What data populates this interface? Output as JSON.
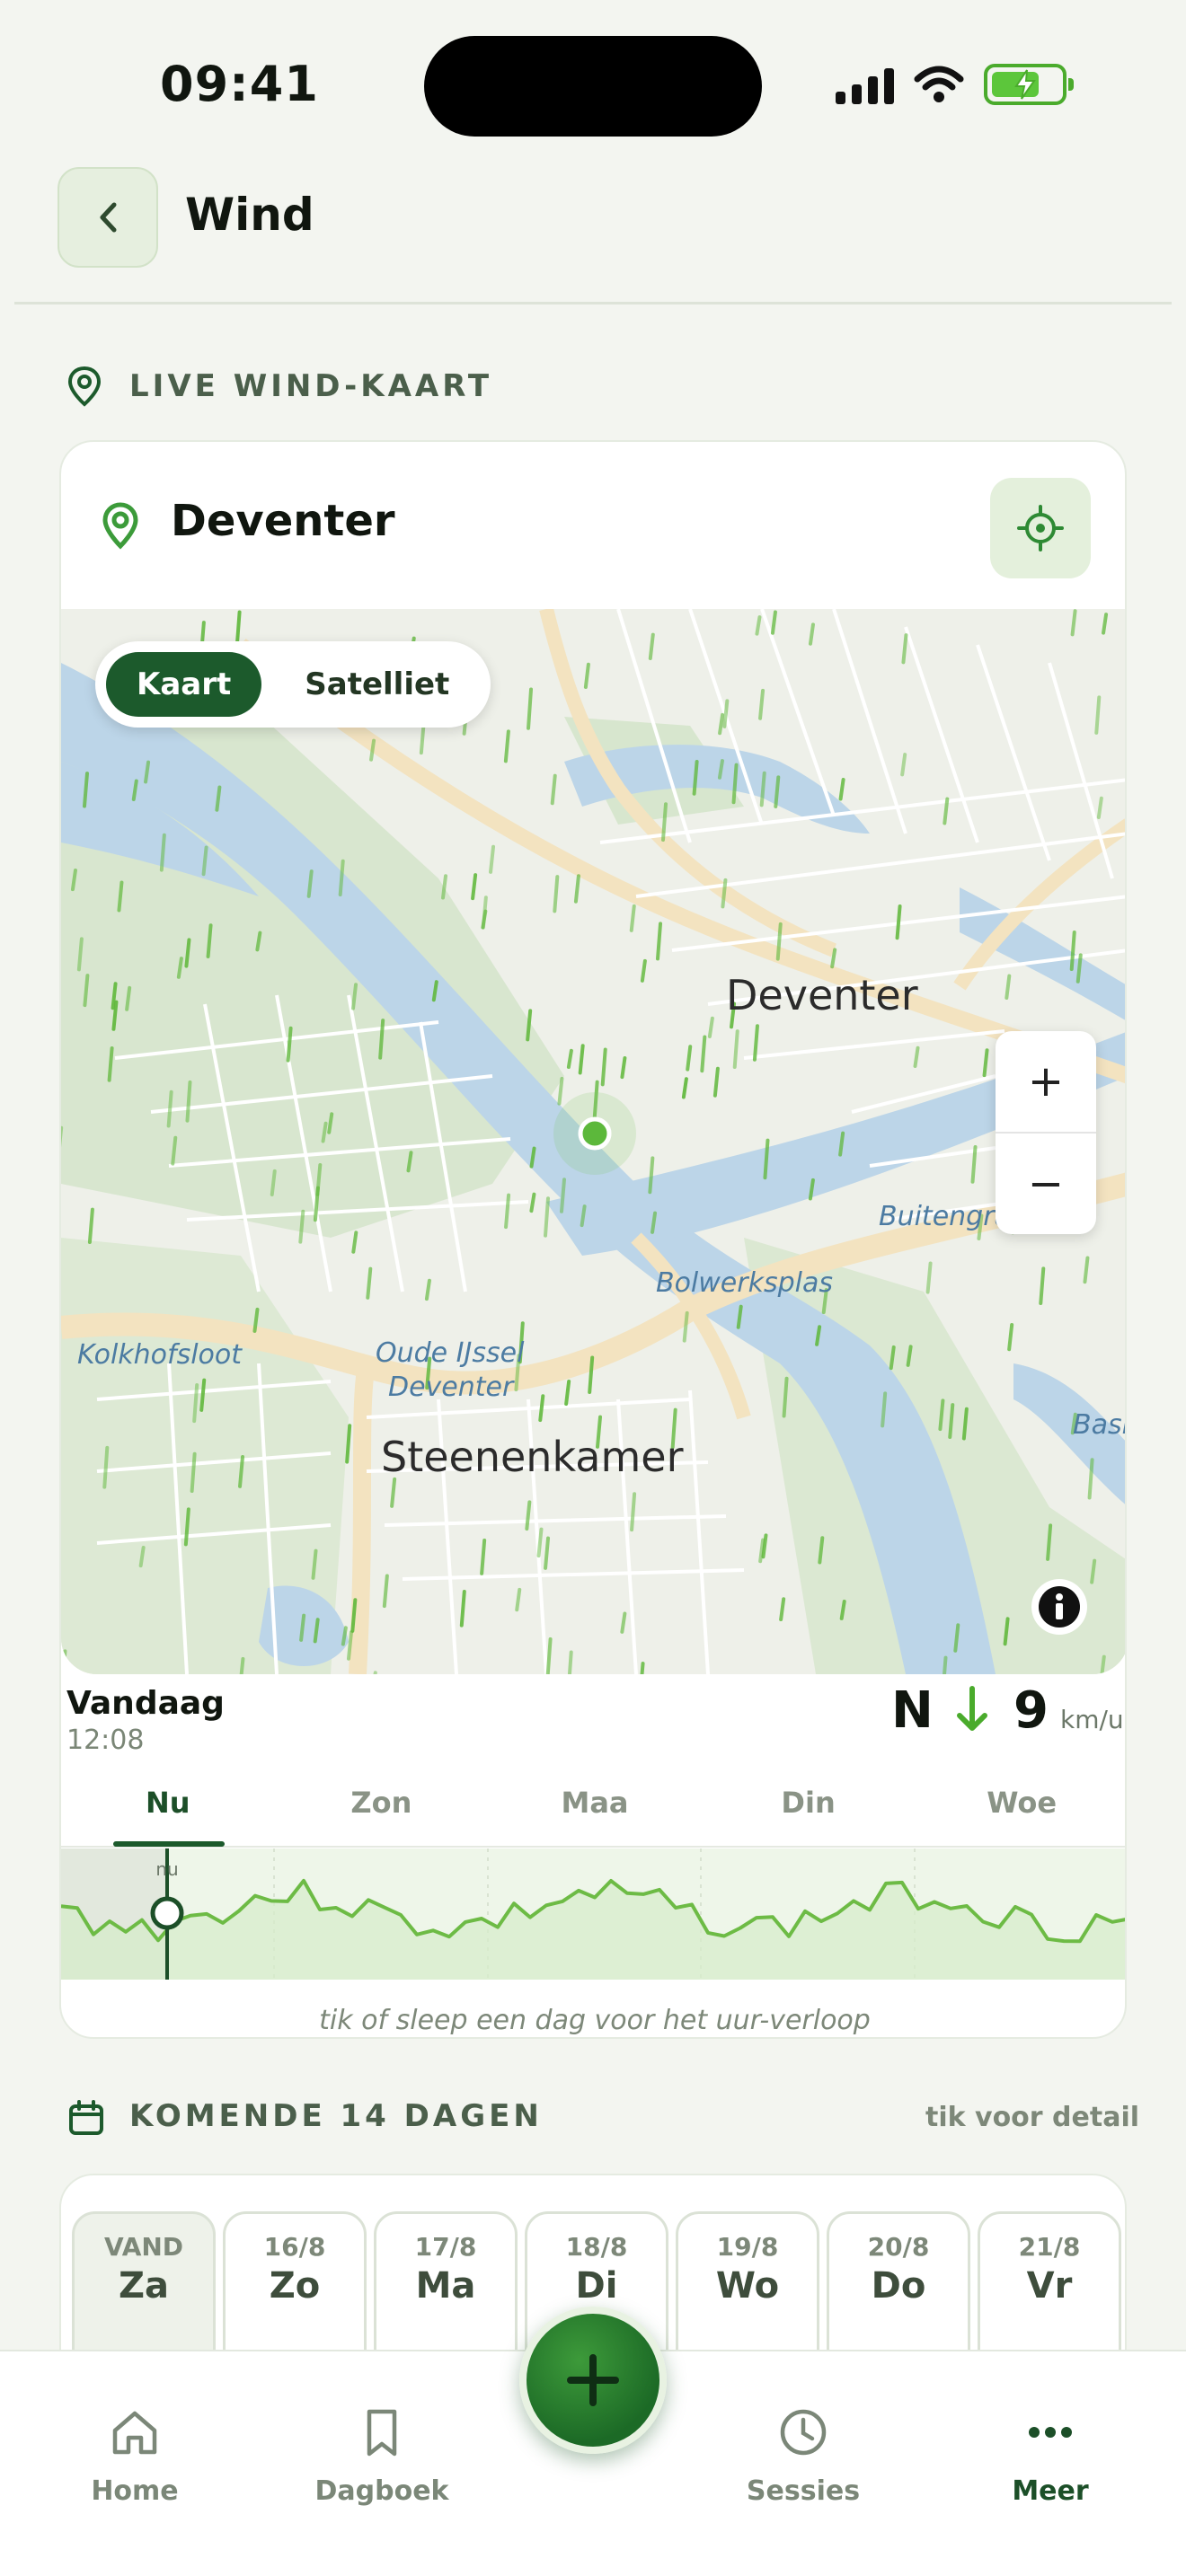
{
  "status_bar": {
    "time": "09:41"
  },
  "header": {
    "title": "Wind"
  },
  "live_section": {
    "label": "LIVE WIND-KAART"
  },
  "location": {
    "name": "Deventer"
  },
  "map": {
    "layer_toggle": {
      "map_label": "Kaart",
      "satellite_label": "Satelliet",
      "selected": "Kaart"
    },
    "labels": {
      "deventer": "Deventer",
      "steenenkamer": "Steenenkamer",
      "bolwerksplas": "Bolwerksplas",
      "kolkhofsloot": "Kolkhofsloot",
      "oude_ijssel_1": "Oude IJssel",
      "oude_ijssel_2": "Deventer",
      "buitengracht": "Buitengra",
      "basi": "Basi"
    },
    "zoom_in_label": "+",
    "zoom_out_label": "−"
  },
  "forecast": {
    "day": "Vandaag",
    "time": "12:08",
    "direction": "N",
    "speed": "9",
    "unit": "km/u",
    "tabs": [
      "Nu",
      "Zon",
      "Maa",
      "Din",
      "Woe"
    ],
    "active_tab": "Nu",
    "graph_marker_label": "nu",
    "hint": "tik of sleep een dag voor het uur-verloop"
  },
  "days_section": {
    "label": "KOMENDE 14 DAGEN",
    "hint": "tik voor detail"
  },
  "days": [
    {
      "date": "VAND",
      "day": "Za"
    },
    {
      "date": "16/8",
      "day": "Zo"
    },
    {
      "date": "17/8",
      "day": "Ma"
    },
    {
      "date": "18/8",
      "day": "Di"
    },
    {
      "date": "19/8",
      "day": "Wo"
    },
    {
      "date": "20/8",
      "day": "Do"
    },
    {
      "date": "21/8",
      "day": "Vr"
    }
  ],
  "tabbar": {
    "home": "Home",
    "dagboek": "Dagboek",
    "sessies": "Sessies",
    "meer": "Meer",
    "active": "Meer"
  },
  "colors": {
    "accent": "#1c5a2c",
    "accent_light": "#4aab2c",
    "water": "#bcd5e8",
    "background": "#f3f5f0"
  }
}
